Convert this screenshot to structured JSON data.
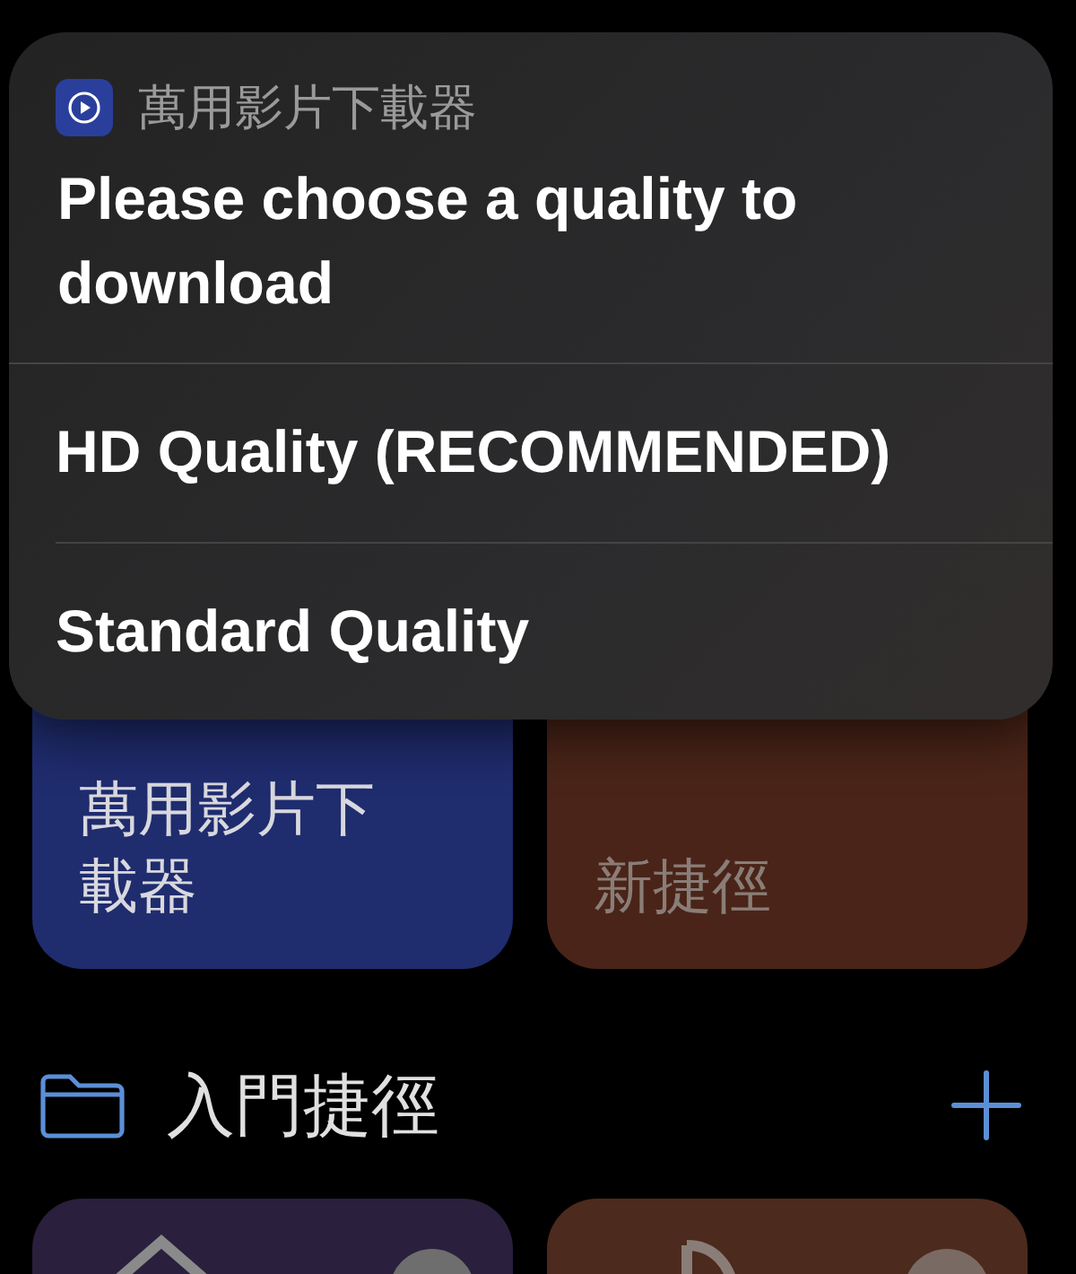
{
  "alert": {
    "app_title": "萬用影片下載器",
    "message": "Please choose a quality to download",
    "options": [
      {
        "label": "HD Quality (RECOMMENDED)"
      },
      {
        "label": "Standard Quality"
      }
    ]
  },
  "shortcuts": [
    {
      "name": "萬用影片下載器",
      "color": "#1f2c6e"
    },
    {
      "name": "新捷徑",
      "color": "#4a2418"
    }
  ],
  "folder": {
    "title": "入門捷徑"
  },
  "starter_shortcuts": [
    {
      "color": "#2a1f3c"
    },
    {
      "color": "#4c2a1e"
    }
  ]
}
